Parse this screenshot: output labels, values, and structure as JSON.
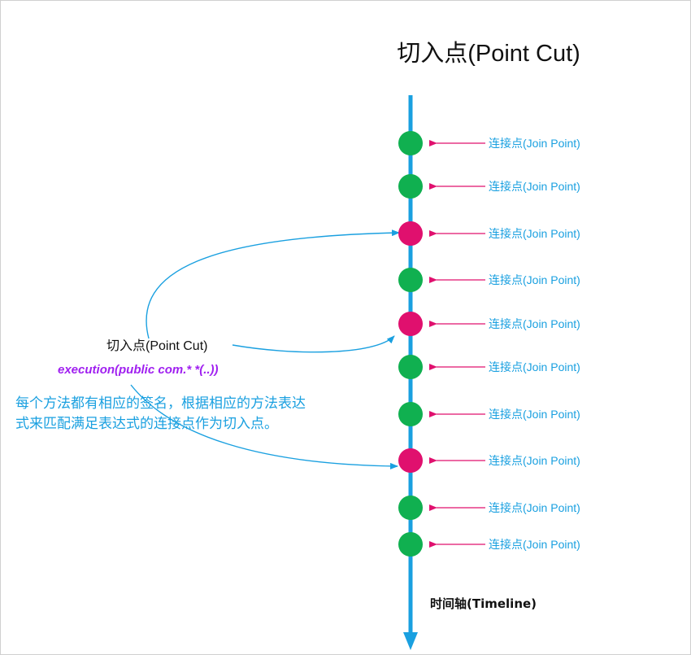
{
  "title": "切入点(Point Cut)",
  "timeline_label": "时间轴(Timeline)",
  "pointcut_label": "切入点(Point Cut)",
  "expression": "execution(public com.* *(..))",
  "description_lines": [
    "每个方法都有相应的签名，根据相应的方法表达",
    "式来匹配满足表达式的连接点作为切入点。"
  ],
  "join_point_label": "连接点(Join Point)",
  "join_points": [
    {
      "label": "连接点(Join Point)",
      "matched": false
    },
    {
      "label": "连接点(Join Point)",
      "matched": false
    },
    {
      "label": "连接点(Join Point)",
      "matched": true
    },
    {
      "label": "连接点(Join Point)",
      "matched": false
    },
    {
      "label": "连接点(Join Point)",
      "matched": true
    },
    {
      "label": "连接点(Join Point)",
      "matched": false
    },
    {
      "label": "连接点(Join Point)",
      "matched": false
    },
    {
      "label": "连接点(Join Point)",
      "matched": true
    },
    {
      "label": "连接点(Join Point)",
      "matched": false
    },
    {
      "label": "连接点(Join Point)",
      "matched": false
    }
  ],
  "colors": {
    "timeline": "#1aa0e0",
    "join_point": "#10b050",
    "matched_join_point": "#e0106e",
    "pointer_arrow": "#e0106e",
    "curve": "#1aa0e0",
    "expression": "#a020f0",
    "description": "#1aa0e0"
  }
}
